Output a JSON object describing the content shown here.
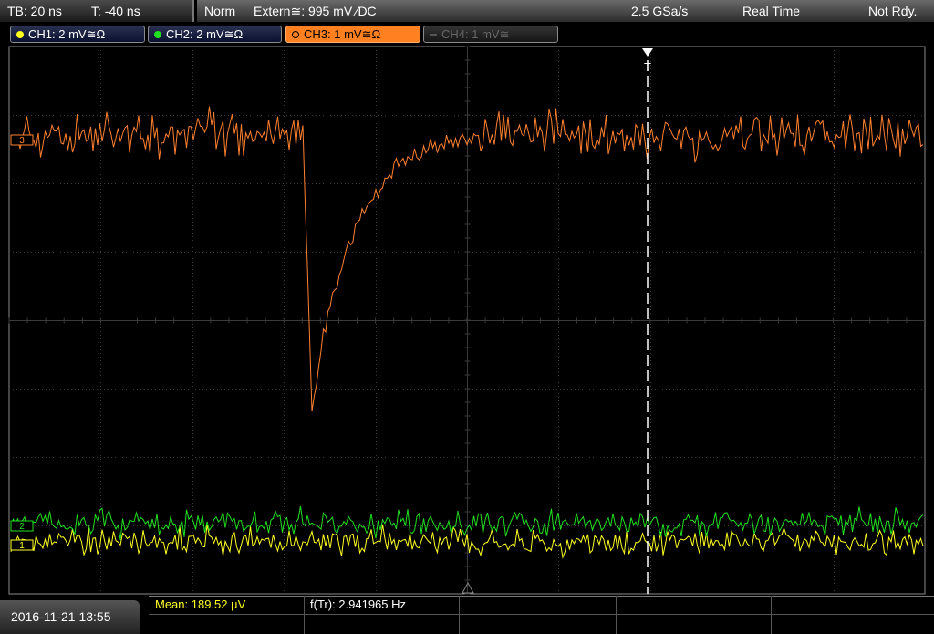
{
  "header": {
    "timebase": "TB: 20 ns",
    "trigger_time": "T: -40 ns",
    "trigger_mode": "Norm",
    "trigger_source": "Extern≅: 995 mV ⁄DC",
    "sample_rate": "2.5 GSa/s",
    "acq_mode": "Real Time",
    "status": "Not Rdy."
  },
  "channels": [
    {
      "label": "CH1: 2 mV≅Ω",
      "color": "#ffff20",
      "state": "on"
    },
    {
      "label": "CH2: 2 mV≅Ω",
      "color": "#20e020",
      "state": "on"
    },
    {
      "label": "CH3: 1 mV≅Ω",
      "color": "#ff8020",
      "state": "active"
    },
    {
      "label": "CH4: 1 mV≅",
      "color": "#555555",
      "state": "off"
    }
  ],
  "markers": {
    "ch1": "1",
    "ch2": "2",
    "ch3": "3",
    "trigger": "T"
  },
  "footer": {
    "datetime": "2016-11-21 13:55",
    "mean": "Mean: 189.52 µV",
    "freq": "f(Tr): 2.941965 Hz"
  },
  "colors": {
    "ch1": "#ffff20",
    "ch2": "#20e020",
    "ch3": "#ff8030",
    "grid": "#444444",
    "trigger_line": "#ffffff"
  }
}
